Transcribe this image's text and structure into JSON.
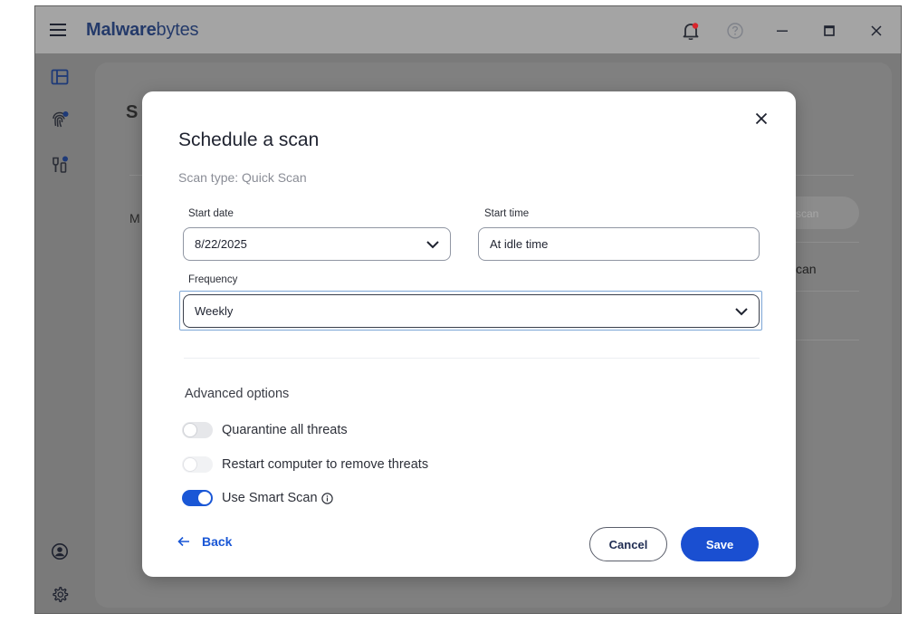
{
  "app": {
    "logo_bold": "alware",
    "logo_light": "bytes",
    "logo_mark": "M"
  },
  "background": {
    "heading_fragment": "S",
    "text_fragment": "M",
    "pill_fragment": "scan",
    "row_fragment": "can"
  },
  "dialog": {
    "title": "Schedule a scan",
    "scan_type": "Scan type: Quick Scan",
    "start_date": {
      "label": "Start date",
      "value": "8/22/2025"
    },
    "start_time": {
      "label": "Start time",
      "value": "At idle time"
    },
    "frequency": {
      "label": "Frequency",
      "value": "Weekly"
    },
    "advanced_title": "Advanced options",
    "options": [
      {
        "label": "Quarantine all threats",
        "enabled": false
      },
      {
        "label": "Restart computer to remove threats",
        "enabled": false
      },
      {
        "label": "Use Smart Scan",
        "enabled": true
      }
    ],
    "back_label": "Back",
    "cancel_label": "Cancel",
    "save_label": "Save"
  },
  "colors": {
    "accent": "#1a4fd1",
    "toggle_on": "#1a57d6",
    "notification_dot": "#d9262c"
  }
}
